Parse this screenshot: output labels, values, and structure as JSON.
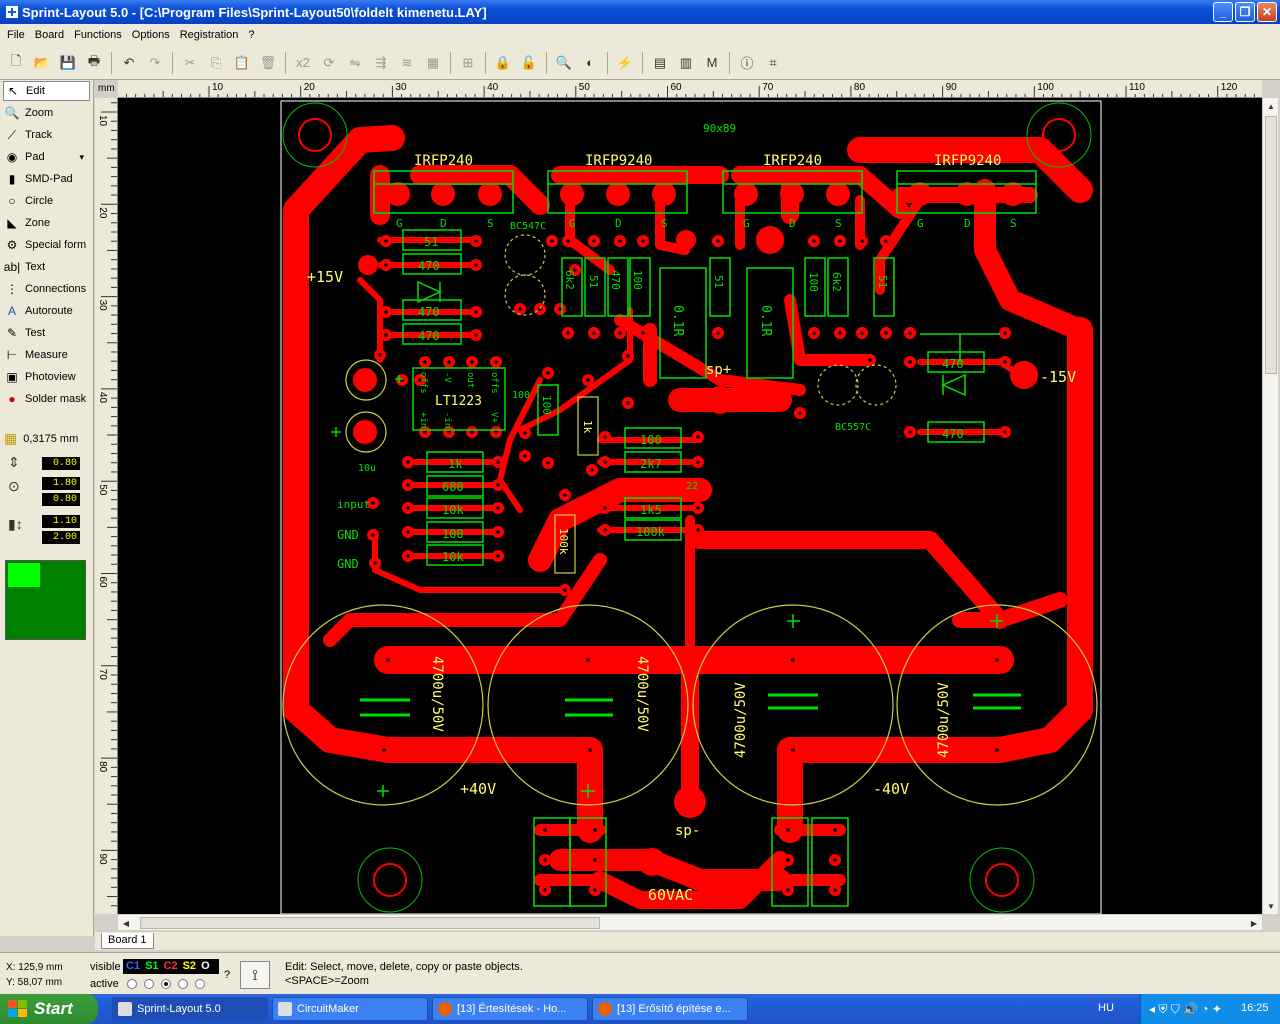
{
  "window": {
    "title": "Sprint-Layout 5.0 - [C:\\Program Files\\Sprint-Layout50\\foldelt kimenetu.LAY]",
    "controls": [
      "_",
      "❐",
      "✕"
    ]
  },
  "menu": [
    "File",
    "Board",
    "Functions",
    "Options",
    "Registration",
    "?"
  ],
  "toolbar": {
    "zoom_factor_label": "x2"
  },
  "tools": [
    {
      "label": "Edit",
      "icon": "arrow-icon",
      "glyph": "↖"
    },
    {
      "label": "Zoom",
      "icon": "magnifier-icon",
      "glyph": "🔍"
    },
    {
      "label": "Track",
      "icon": "track-icon",
      "glyph": "⟋"
    },
    {
      "label": "Pad",
      "icon": "pad-icon",
      "glyph": "◉"
    },
    {
      "label": "SMD-Pad",
      "icon": "smd-pad-icon",
      "glyph": "▮"
    },
    {
      "label": "Circle",
      "icon": "circle-icon",
      "glyph": "○"
    },
    {
      "label": "Zone",
      "icon": "zone-icon",
      "glyph": "◣"
    },
    {
      "label": "Special form",
      "icon": "special-form-icon",
      "glyph": "⚙"
    },
    {
      "label": "Text",
      "icon": "text-icon",
      "glyph": "ab|"
    },
    {
      "label": "Connections",
      "icon": "connections-icon",
      "glyph": "⋮"
    },
    {
      "label": "Autoroute",
      "icon": "autoroute-icon",
      "glyph": "A"
    },
    {
      "label": "Test",
      "icon": "test-icon",
      "glyph": "✎"
    },
    {
      "label": "Measure",
      "icon": "measure-icon",
      "glyph": "⊢"
    },
    {
      "label": "Photoview",
      "icon": "photoview-icon",
      "glyph": "▣"
    },
    {
      "label": "Solder mask",
      "icon": "solder-mask-icon",
      "glyph": "●"
    }
  ],
  "grid": {
    "value": "0,3175 mm"
  },
  "track_width": "0.80",
  "pad_outer": "1.80",
  "pad_inner": "0.80",
  "smd_width": "1.10",
  "smd_height": "2.00",
  "ruler": {
    "unit": "mm",
    "h_ticks": [
      "10",
      "20",
      "30",
      "40",
      "50",
      "60",
      "70",
      "80",
      "90",
      "100",
      "110",
      "120"
    ],
    "v_ticks": [
      "10",
      "20",
      "30",
      "40",
      "50",
      "60",
      "70",
      "80",
      "90"
    ]
  },
  "board": {
    "size_label": "90x89",
    "labels": {
      "irfp240_1": "IRFP240",
      "irfp9240_1": "IRFP9240",
      "irfp240_2": "IRFP240",
      "irfp9240_2": "IRFP9240",
      "gds": [
        "G",
        "D",
        "S"
      ],
      "plus15": "+15V",
      "minus15": "-15V",
      "bc547": "BC547C",
      "bc557": "BC557C",
      "lt1223": "LT1223",
      "input": "input",
      "gnd": "GND",
      "plus40": "+40V",
      "minus40": "-40V",
      "sp_plus": "sp+",
      "sp_minus": "sp-",
      "vac": "60VAC",
      "cap": "4700u/50V",
      "res": {
        "r51a": "51",
        "r470a": "470",
        "r470b": "470",
        "r470c": "470",
        "r6k2a": "6k2",
        "r51b": "51",
        "r470d": "470",
        "r100a": "100",
        "r01a": "0.1R",
        "r51c": "51",
        "r01b": "0.1R",
        "r100b": "100",
        "r6k2b": "6k2",
        "r51d": "51",
        "r470e": "470",
        "r470f": "470",
        "r1k": "1k",
        "r680": "680",
        "r10k": "10k",
        "r100c": "100",
        "r10kb": "10k",
        "r100d": "100",
        "r1kb": "1k",
        "r100e": "100",
        "r2k7": "2k7",
        "r1k5": "1k5",
        "r100k": "100k",
        "r100kb": "100k",
        "c22": "22",
        "c10u": "10u"
      },
      "ic_pins": [
        "offs",
        "-V",
        "out",
        "offs",
        "+in",
        "-in",
        "V+"
      ]
    }
  },
  "tabs": [
    "Board 1"
  ],
  "status": {
    "x": "X:  125,9 mm",
    "y": "Y:   58,07 mm",
    "visible_label": "visible",
    "active_label": "active",
    "layers": [
      "C1",
      "S1",
      "C2",
      "S2",
      "O"
    ],
    "hint_line1": "Edit: Select, move, delete, copy or paste objects.",
    "hint_line2": "<SPACE>=Zoom"
  },
  "taskbar": {
    "start": "Start",
    "tasks": [
      "Sprint-Layout 5.0",
      "CircuitMaker",
      "[13] Értesítések - Ho...",
      "[13] Erősítő építése e..."
    ],
    "lang": "HU",
    "clock": "16:25"
  },
  "colors": {
    "copper": "#ff0000",
    "silk": "#00ff00",
    "silk_yellow": "#ffff66",
    "board_bg": "#000000"
  }
}
